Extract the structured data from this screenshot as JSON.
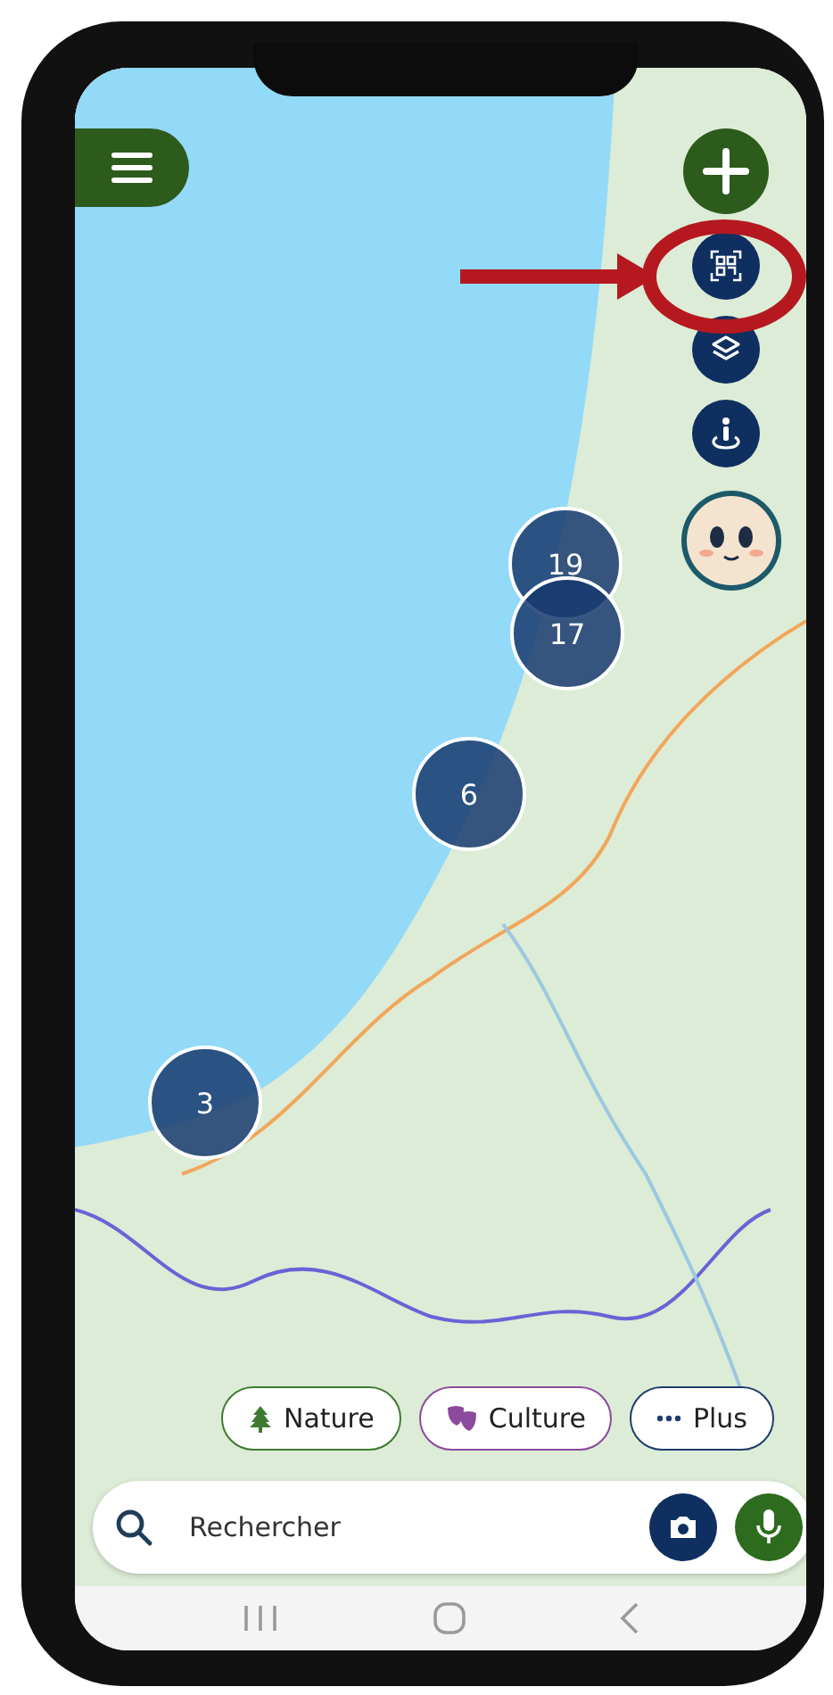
{
  "map_clusters": [
    {
      "count": "19"
    },
    {
      "count": "17"
    },
    {
      "count": "6"
    },
    {
      "count": "3"
    }
  ],
  "categories": [
    {
      "label": "Nature",
      "kind": "tree",
      "color": "#3d7a30"
    },
    {
      "label": "Culture",
      "kind": "masks",
      "color": "#8b4a9c"
    },
    {
      "label": "Plus",
      "kind": "dots",
      "color": "#1f3d6e"
    }
  ],
  "search": {
    "placeholder": "Rechercher"
  }
}
